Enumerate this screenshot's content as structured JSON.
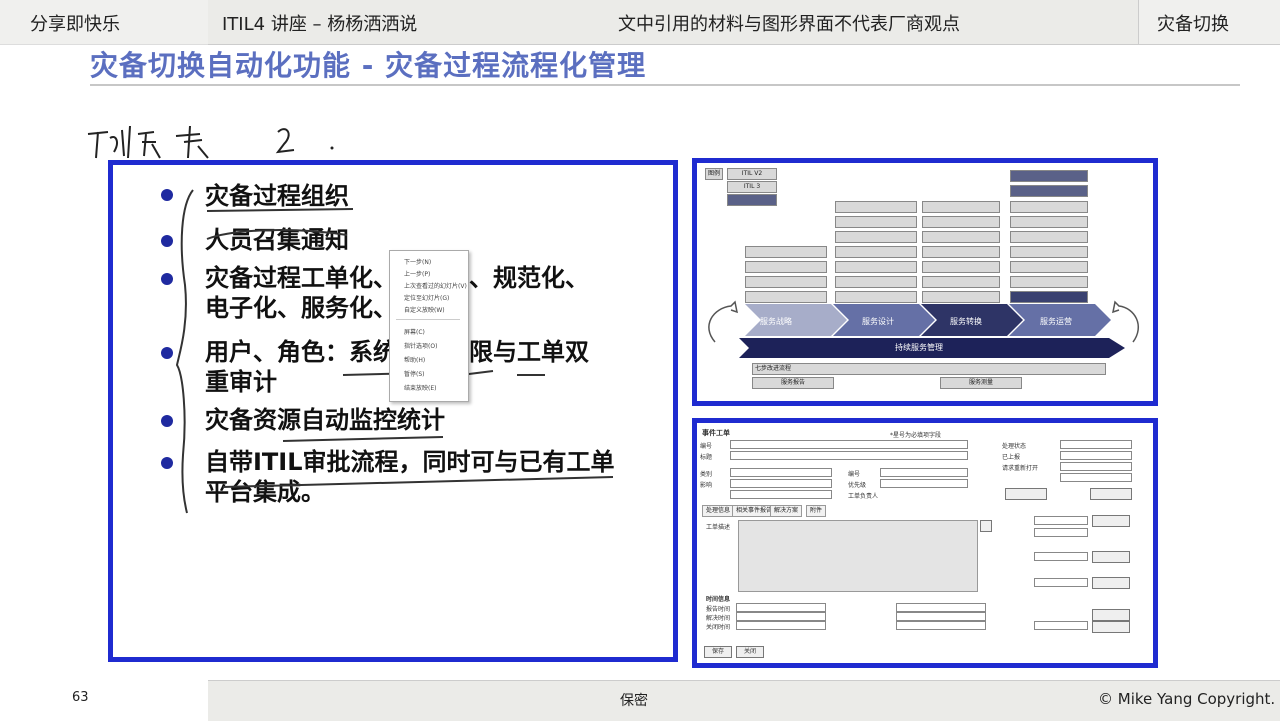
{
  "header": {
    "channel": "分享即快乐",
    "course": "ITIL4 讲座 – 杨杨洒洒说",
    "disclaimer": "文中引用的材料与图形界面不代表厂商观点",
    "section": "灾备切换"
  },
  "slide": {
    "title": "灾备切换自动化功能 - 灾备过程流程化管理",
    "handwriting": "功换 2.",
    "bullets": [
      {
        "lines": [
          "灾备过程组织"
        ]
      },
      {
        "lines": [
          "人员召集通知"
        ]
      },
      {
        "lines": [
          "灾备过程工单化、流程化、规范化、",
          "电子化、服务化、自动化"
        ]
      },
      {
        "lines": [
          "用户、角色：系统数据权限与工单双",
          "重审计"
        ]
      },
      {
        "lines": [
          "灾备资源自动监控统计"
        ]
      },
      {
        "lines": [
          "自带ITIL审批流程，同时可与已有工单",
          "平台集成。"
        ]
      }
    ]
  },
  "context_menu": {
    "items": [
      "下一步(N)",
      "上一步(P)",
      "上次查看过的幻灯片(V)",
      "定位至幻灯片(G)",
      "自定义放映(W)",
      "屏幕(C)",
      "指针选项(O)",
      "帮助(H)",
      "暂停(S)",
      "结束放映(E)"
    ]
  },
  "itil_diagram": {
    "version_labels": [
      "ITIL V2",
      "ITIL 3",
      "图例"
    ],
    "stages": [
      "服务战略",
      "服务设计",
      "服务转换",
      "服务运营"
    ],
    "base_bar": "持续服务管理",
    "bottom_left": "服务报告",
    "bottom_right": "服务测量",
    "bottom_bar": "七步改进流程"
  },
  "incident_form": {
    "title": "事件工单",
    "required_note": "*星号为必填项字段",
    "tabs": [
      "处理信息",
      "相关事件报告",
      "解决方案",
      "附件"
    ],
    "buttons": [
      "保存",
      "关闭"
    ],
    "labels": [
      "编号",
      "标题",
      "类别",
      "影响",
      "优先级",
      "工单负责人",
      "处理状态",
      "已上报",
      "请求重新打开",
      "工单描述",
      "时间信息",
      "报告时间",
      "解决时间",
      "关闭时间"
    ]
  },
  "footer": {
    "page": "63",
    "confidential": "保密",
    "copyright": "© Mike Yang Copyright."
  }
}
